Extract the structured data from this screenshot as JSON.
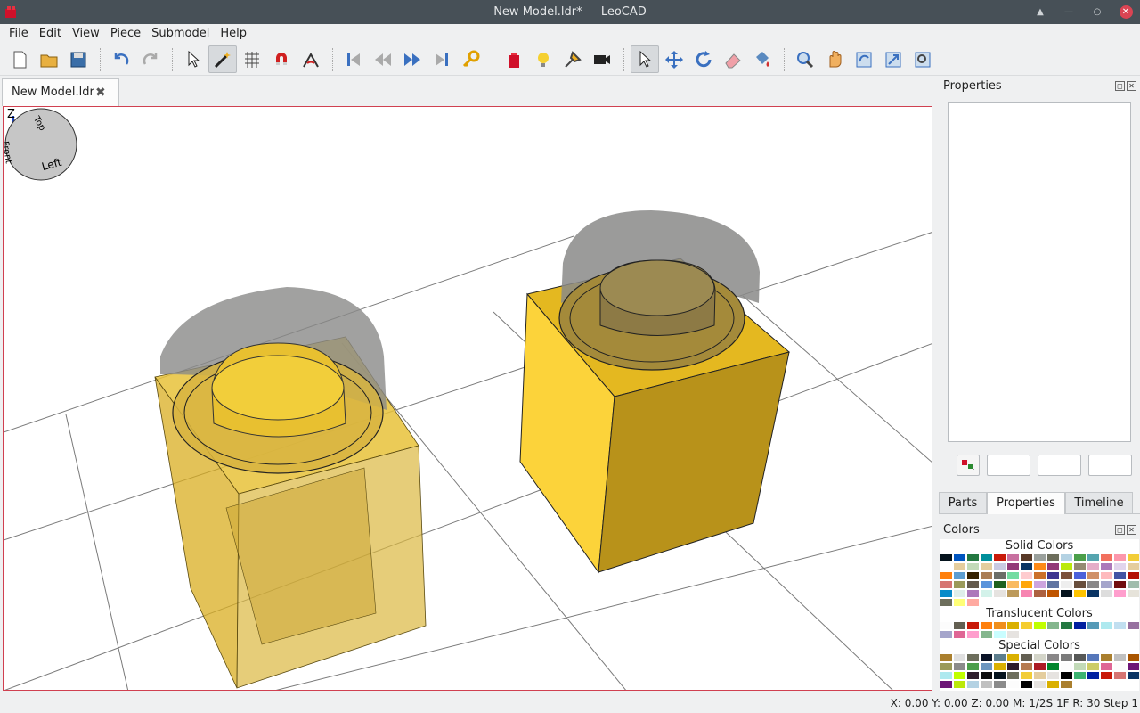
{
  "window": {
    "title": "New Model.ldr* — LeoCAD"
  },
  "menu": [
    "File",
    "Edit",
    "View",
    "Piece",
    "Submodel",
    "Help"
  ],
  "toolbar": {
    "buttons": [
      "new-file-icon",
      "open-folder-icon",
      "save-icon",
      "sep",
      "undo-icon",
      "redo-icon",
      "sep",
      "select-arrow-icon",
      "magic-wand-icon",
      "grid-snap-icon",
      "magnet-icon",
      "angle-snap-icon",
      "sep",
      "first-step-icon",
      "previous-step-icon",
      "next-step-icon",
      "last-step-icon",
      "key-icon",
      "sep",
      "insert-brick-icon",
      "light-bulb-icon",
      "spotlight-icon",
      "camera-icon",
      "sep",
      "select-tool-icon",
      "move-tool-icon",
      "rotate-tool-icon",
      "eraser-icon",
      "paint-icon",
      "sep",
      "zoom-icon",
      "pan-icon",
      "orbit-icon",
      "roll-icon",
      "zoom-extents-icon"
    ],
    "active": [
      "magic-wand-icon",
      "select-tool-icon"
    ]
  },
  "document": {
    "tab_label": "New Model.ldr",
    "close_glyph": "✖"
  },
  "viewport": {
    "axis_labels": {
      "z": "Z",
      "y": "Y",
      "x": "X"
    },
    "sphere_labels": {
      "top": "Top",
      "left": "Left",
      "front": "Front"
    }
  },
  "properties_panel": {
    "title": "Properties"
  },
  "bottom_tabs": [
    {
      "label": "Parts"
    },
    {
      "label": "Properties",
      "active": true
    },
    {
      "label": "Timeline"
    }
  ],
  "colors_panel": {
    "title": "Colors",
    "categories": [
      {
        "name": "Solid Colors",
        "swatches": [
          "#05131d",
          "#0055bf",
          "#237841",
          "#008f9b",
          "#c91a09",
          "#c870a0",
          "#583927",
          "#9ba19d",
          "#6d6e5c",
          "#b4d2e3",
          "#4b9f4a",
          "#55a5af",
          "#f2705e",
          "#fc97ac",
          "#f2cd37",
          "#ffffff",
          "#e4cd9e",
          "#c2dab8",
          "#e4cd9e",
          "#c9cae2",
          "#923978",
          "#0a3463",
          "#fe8a18",
          "#923978",
          "#bbe90b",
          "#958a73",
          "#e4adc8",
          "#ac78ba",
          "#e1d5ed",
          "#e4cd9e",
          "#ff800d",
          "#5c9dd1",
          "#352100",
          "#aa7d55",
          "#6c6e68",
          "#73dca1",
          "#fecccf",
          "#cc702a",
          "#3f3691",
          "#7c503a",
          "#4c61db",
          "#d09168",
          "#feba bd",
          "#4354a3",
          "#b31004",
          "#d67572",
          "#9b9a5a",
          "#645a4c",
          "#5a93db",
          "#1e601e",
          "#f9ba61",
          "#ffa70b",
          "#cda4de",
          "#6074a1",
          "#eeeeee",
          "#684e3c",
          "#898788",
          "#a5a5cb",
          "#720e0f",
          "#a0bcac",
          "#078bc9",
          "#dfeeea",
          "#ac78ba",
          "#d3f2ea",
          "#e6e3e0",
          "#bc9a5b",
          "#f785b1",
          "#ad6140",
          "#bf5500",
          "#05131d",
          "#fec401",
          "#0a3463",
          "#ddd",
          "#ff9ecd",
          "#e6e3da",
          "#6d6e5c",
          "#ff7",
          "#ffaaa1"
        ]
      },
      {
        "name": "Translucent Colors",
        "swatches": [
          "#fcfcfc",
          "#635f52",
          "#c91a09",
          "#ff800d",
          "#f08f1c",
          "#dab000",
          "#f5cd2f",
          "#c0ff00",
          "#84b68d",
          "#237841",
          "#0020a0",
          "#559ab7",
          "#aee9ef",
          "#c1dff0",
          "#96709f",
          "#a5a5cb",
          "#df6695",
          "#ff9ecd",
          "#84b68d",
          "#c9fdff",
          "#e6e3e0"
        ]
      },
      {
        "name": "Special Colors",
        "swatches": [
          "#aa7f2e",
          "#e0e0e0",
          "#6d6e5c",
          "#0a1327",
          "#5e7f8e",
          "#dab000",
          "#635f52",
          "#d4d5c9",
          "#898788",
          "#7b7b7b",
          "#575857",
          "#5677ba",
          "#aa7f2e",
          "#c0c0c0",
          "#a95500",
          "#9b9a5a",
          "#8b8b8b",
          "#4b9f4a",
          "#6c96bf",
          "#dab000",
          "#2e1d2b",
          "#b67b50",
          "#ac1b24",
          "#00852b",
          "#fcfcfc",
          "#c2dab8",
          "#cccc66",
          "#df6695",
          "#fcfcfc",
          "#6d1577",
          "#aee9ef",
          "#c0ff00",
          "#2e1d2b",
          "#0d0d0d",
          "#05131d",
          "#6d6e5c",
          "#f2cd37",
          "#e4cd9e",
          "#e6e3e0",
          "#000",
          "#3cb371",
          "#0020a0",
          "#c91a09",
          "#d67572",
          "#0a3463",
          "#6d1577",
          "#bbe90b",
          "#b4d2e3",
          "#c0c0c0",
          "#8b8b8b",
          "#fcfcfc",
          "#000",
          "#e6e3e0",
          "#dab000",
          "#aa7f2e"
        ]
      }
    ]
  },
  "status": {
    "text": "X: 0.00 Y: 0.00 Z: 0.00   M: 1/2S 1F R: 30   Step 1"
  }
}
